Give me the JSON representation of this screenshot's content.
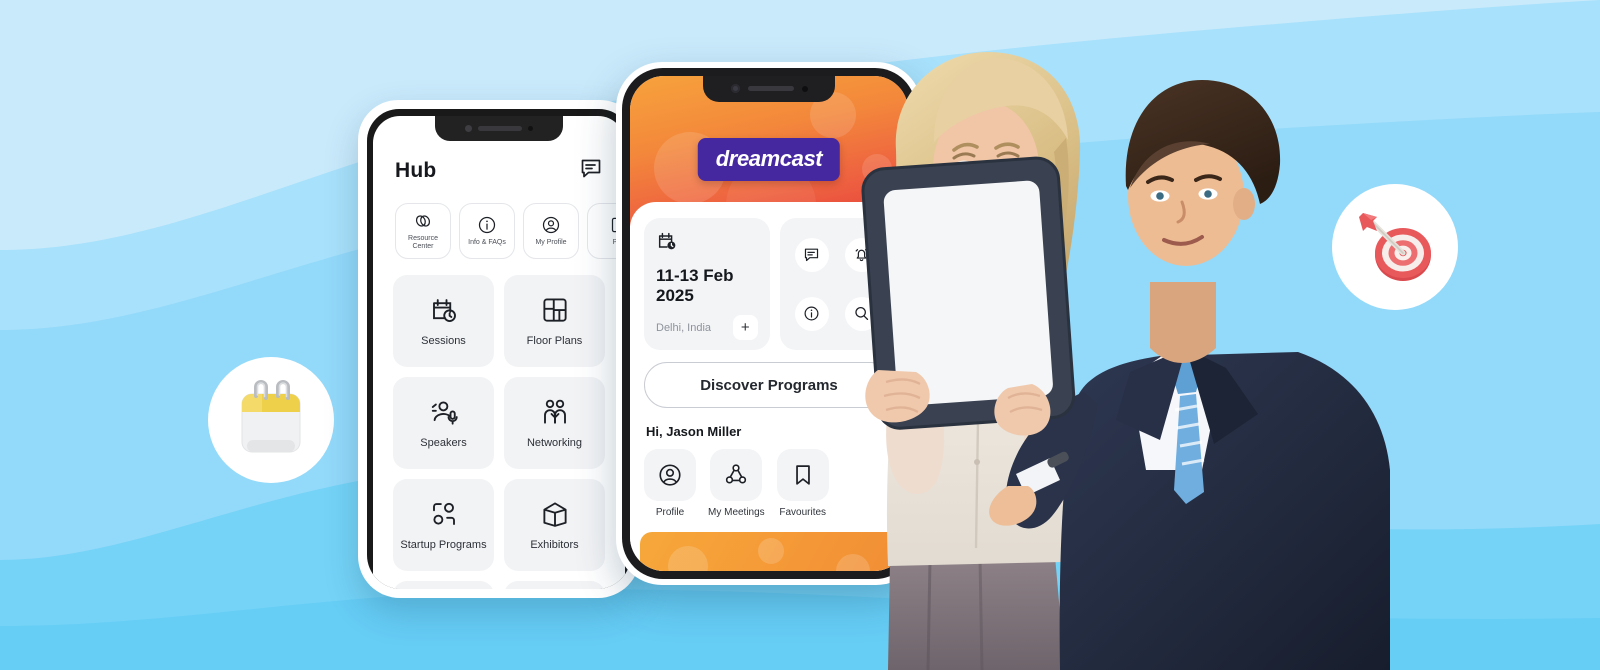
{
  "theme": {
    "bg_light": "#C9EAFB",
    "bg_mid": "#AEE3FA",
    "bg_deep": "#74D3F7",
    "brand_purple": "#4527A0",
    "orange_start": "#F7A23C",
    "orange_end": "#E63F3C",
    "alert_red": "#E8362C",
    "calendar_yellow": "#EFD04B",
    "target_red": "#E8595C",
    "suit_navy": "#232A3D"
  },
  "back_phone": {
    "header": {
      "title": "Hub",
      "chat_icon": "chat-bubble-icon"
    },
    "chips": [
      {
        "label": "Resource Center",
        "icon": "link-rings-icon"
      },
      {
        "label": "Info & FAQs",
        "icon": "info-circle-icon"
      },
      {
        "label": "My Profile",
        "icon": "user-circle-icon"
      },
      {
        "label": "P",
        "icon": "partial-icon"
      }
    ],
    "tiles": [
      {
        "label": "Sessions",
        "icon": "calendar-clock-icon"
      },
      {
        "label": "Floor Plans",
        "icon": "floor-plan-grid-icon"
      },
      {
        "label": "Speakers",
        "icon": "speaker-mic-icon"
      },
      {
        "label": "Networking",
        "icon": "networking-people-icon"
      },
      {
        "label": "Startup Programs",
        "icon": "startup-nodes-icon"
      },
      {
        "label": "Exhibitors",
        "icon": "open-box-icon"
      }
    ]
  },
  "front_phone": {
    "logo": "dreamcast",
    "event": {
      "calendar_icon": "calendar-clock-icon",
      "dates": "11-13 Feb 2025",
      "location": "Delhi, India",
      "add_label": "+"
    },
    "quick_actions": [
      {
        "icon": "chat-bubble-icon",
        "name": "chat",
        "badge": false
      },
      {
        "icon": "bell-icon",
        "name": "notifications",
        "badge": true
      },
      {
        "icon": "info-circle-icon",
        "name": "info",
        "badge": false
      },
      {
        "icon": "search-icon",
        "name": "search",
        "badge": false
      }
    ],
    "cta": {
      "label": "Discover Programs"
    },
    "greeting": "Hi, Jason Miller",
    "shortcuts": [
      {
        "label": "Profile",
        "icon": "user-circle-icon"
      },
      {
        "label": "My Meetings",
        "icon": "meetings-nodes-icon"
      },
      {
        "label": "Favourites",
        "icon": "bookmark-icon"
      }
    ]
  },
  "decorations": [
    {
      "name": "calendar-badge",
      "icon": "desk-calendar-icon"
    },
    {
      "name": "target-badge",
      "icon": "dartboard-arrow-icon"
    }
  ],
  "people": {
    "alt": "Businesswoman and businessman looking at a tablet",
    "tablet": "blank-tablet"
  }
}
